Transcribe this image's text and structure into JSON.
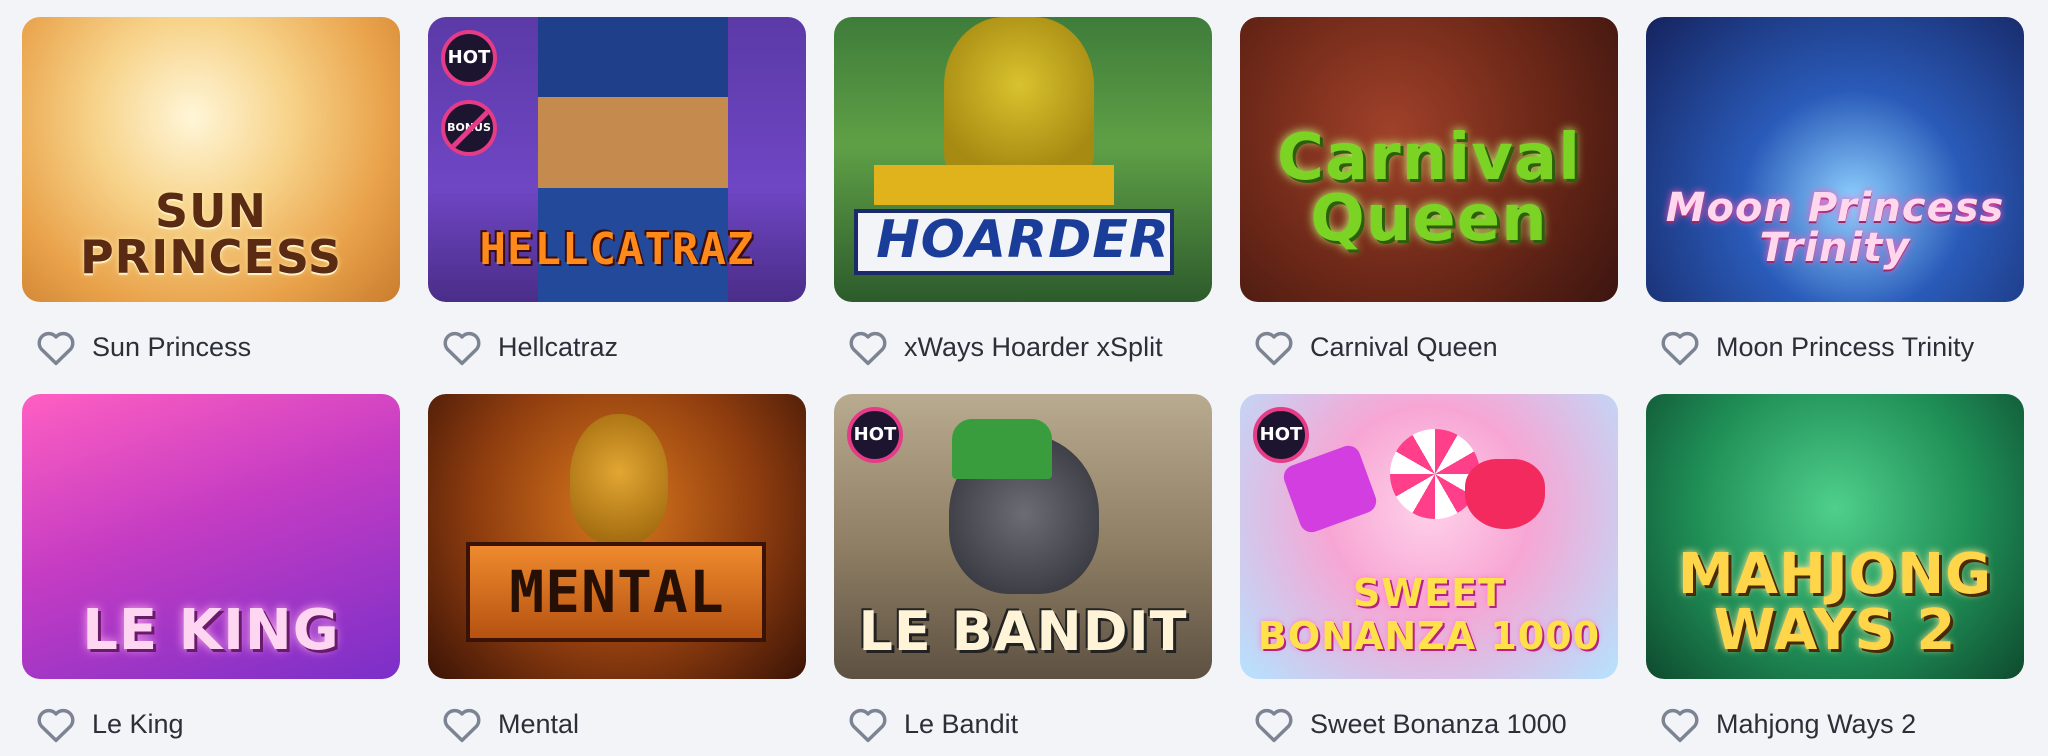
{
  "colors": {
    "background": "#f3f4f7",
    "text": "#2b2f38",
    "heart_outline": "#7c8392",
    "badge_border": "#e63b86"
  },
  "badges": {
    "hot": "HOT",
    "no_bonus": "BONUS"
  },
  "games": [
    {
      "name": "Sun Princess",
      "art_title": "SUN PRINCESS",
      "hot": false,
      "no_bonus": false,
      "favorite_icon": "heart-outline"
    },
    {
      "name": "Hellcatraz",
      "art_title": "HELLCATRAZ",
      "hot": true,
      "no_bonus": true,
      "favorite_icon": "heart-outline"
    },
    {
      "name": "xWays Hoarder xSplit",
      "art_title": "HOARDER",
      "hot": false,
      "no_bonus": false,
      "favorite_icon": "heart-outline"
    },
    {
      "name": "Carnival Queen",
      "art_title": "Carnival Queen",
      "hot": false,
      "no_bonus": false,
      "favorite_icon": "heart-outline"
    },
    {
      "name": "Moon Princess Trinity",
      "art_title": "Moon Princess Trinity",
      "hot": false,
      "no_bonus": false,
      "favorite_icon": "heart-outline"
    },
    {
      "name": "Le King",
      "art_title": "LE KING",
      "hot": false,
      "no_bonus": false,
      "favorite_icon": "heart-outline"
    },
    {
      "name": "Mental",
      "art_title": "MENTAL",
      "hot": false,
      "no_bonus": false,
      "favorite_icon": "heart-outline"
    },
    {
      "name": "Le Bandit",
      "art_title": "LE BANDIT",
      "hot": true,
      "no_bonus": false,
      "favorite_icon": "heart-outline"
    },
    {
      "name": "Sweet Bonanza 1000",
      "art_title": "SWEET BONANZA 1000",
      "hot": true,
      "no_bonus": false,
      "favorite_icon": "heart-outline"
    },
    {
      "name": "Mahjong Ways 2",
      "art_title": "MAHJONG WAYS 2",
      "hot": false,
      "no_bonus": false,
      "favorite_icon": "heart-outline"
    }
  ]
}
